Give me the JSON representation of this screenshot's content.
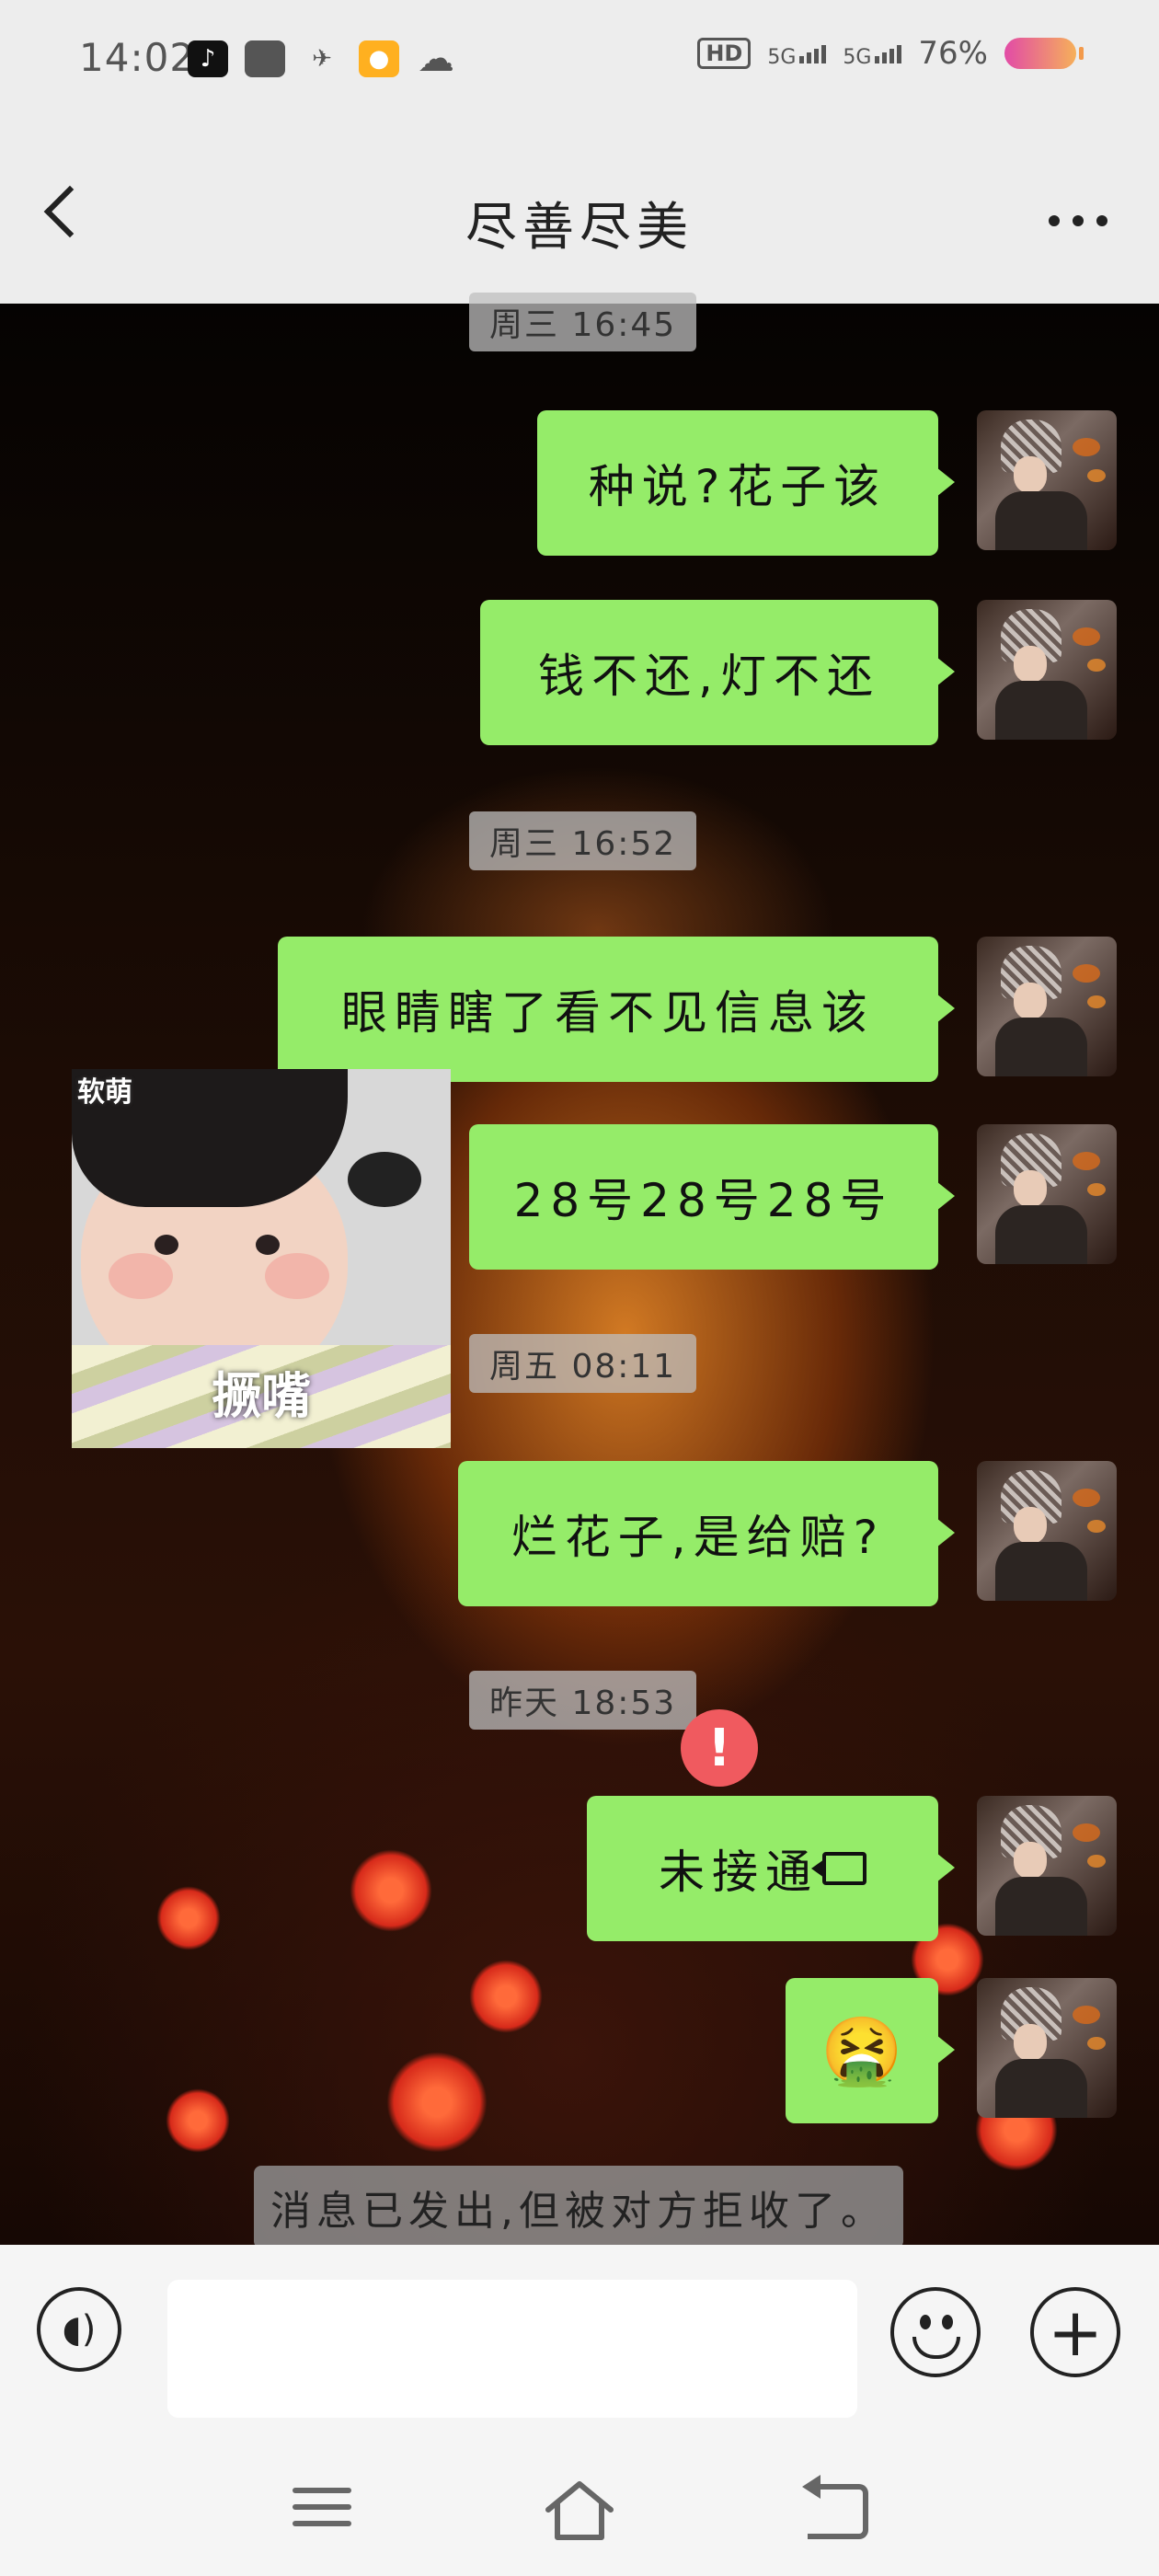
{
  "status_bar": {
    "time": "14:02",
    "battery": "76%",
    "hd": "HD",
    "signal1": "5G",
    "signal2": "5G",
    "app_icons": [
      "tiktok-icon",
      "square-app-icon",
      "bird-icon",
      "duck-icon",
      "cloud-icon"
    ]
  },
  "header": {
    "title": "尽善尽美"
  },
  "messages": [
    {
      "type": "timestamp",
      "text": "周三 16:45"
    },
    {
      "type": "text",
      "text": "种说?花子该"
    },
    {
      "type": "text",
      "text": "钱不还,灯不还"
    },
    {
      "type": "timestamp",
      "text": "周三 16:52"
    },
    {
      "type": "text",
      "text": "眼睛瞎了看不见信息该"
    },
    {
      "type": "text",
      "text": "28号28号28号"
    },
    {
      "type": "timestamp",
      "text": "周五 08:11"
    },
    {
      "type": "text",
      "text": "烂花子,是给赔?"
    },
    {
      "type": "timestamp",
      "text": "昨天 18:53"
    },
    {
      "type": "call",
      "text": "未接通"
    },
    {
      "type": "emoji",
      "text": "🤮"
    }
  ],
  "sticker": {
    "caption": "撅嘴",
    "badge": "软萌"
  },
  "notice": "消息已发出,但被对方拒收了。",
  "error_icon": "!",
  "input": {
    "value": "",
    "plus": "+"
  },
  "colors": {
    "bubble": "#95ec69",
    "error": "#f05a5f",
    "header_bg": "#ededed"
  }
}
